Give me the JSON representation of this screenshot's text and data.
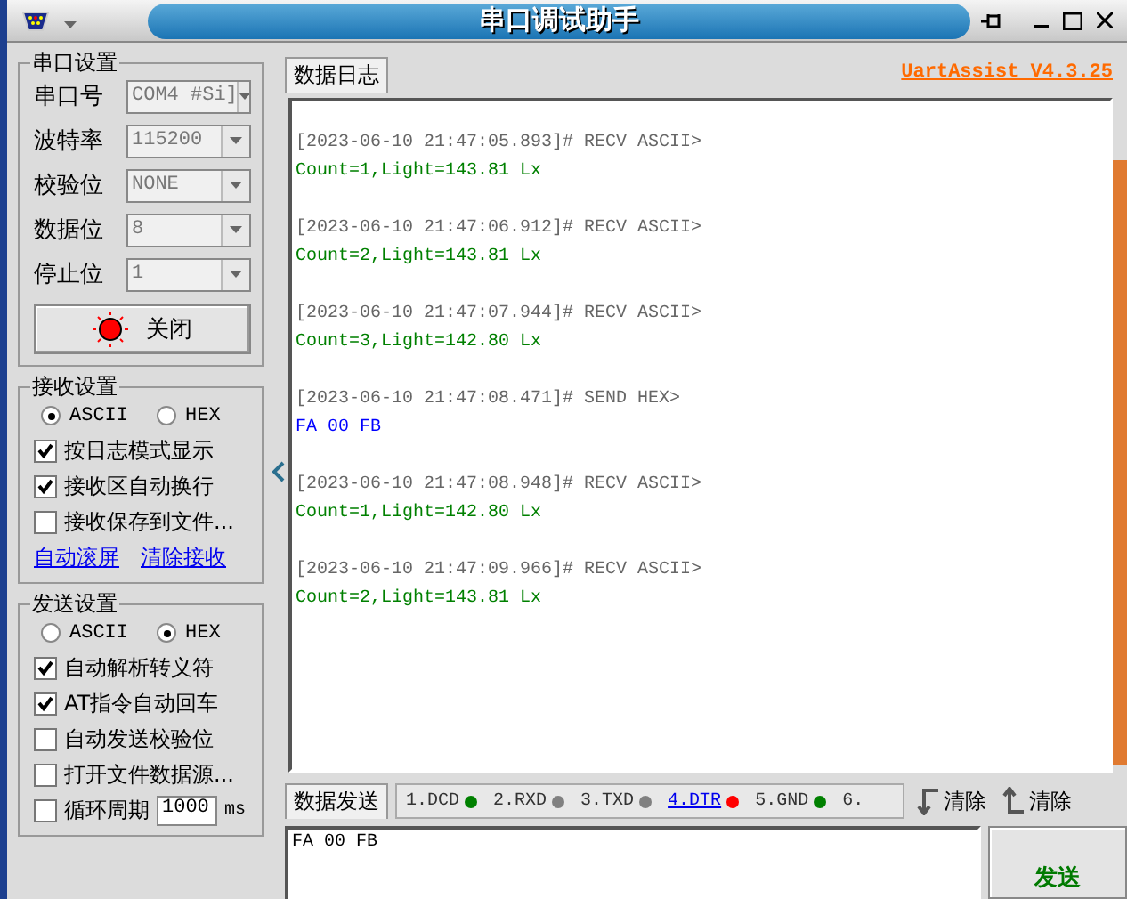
{
  "window": {
    "title": "串口调试助手"
  },
  "port_settings": {
    "title": "串口设置",
    "fields": [
      {
        "label": "串口号",
        "value": "COM4 #Si]"
      },
      {
        "label": "波特率",
        "value": "115200"
      },
      {
        "label": "校验位",
        "value": "NONE"
      },
      {
        "label": "数据位",
        "value": "8"
      },
      {
        "label": "停止位",
        "value": "1"
      }
    ],
    "button": {
      "label": "关闭",
      "on": true
    }
  },
  "receive_settings": {
    "title": "接收设置",
    "modes": [
      {
        "label": "ASCII",
        "selected": true
      },
      {
        "label": "HEX",
        "selected": false
      }
    ],
    "options": [
      {
        "label": "按日志模式显示",
        "checked": true
      },
      {
        "label": "接收区自动换行",
        "checked": true
      },
      {
        "label": "接收保存到文件...",
        "checked": false
      }
    ],
    "links": [
      "自动滚屏",
      "清除接收"
    ]
  },
  "send_settings": {
    "title": "发送设置",
    "modes": [
      {
        "label": "ASCII",
        "selected": false
      },
      {
        "label": "HEX",
        "selected": true
      }
    ],
    "options": [
      {
        "label": "自动解析转义符",
        "checked": true
      },
      {
        "label": "AT指令自动回车",
        "checked": true
      },
      {
        "label": "自动发送校验位",
        "checked": false
      },
      {
        "label": "打开文件数据源...",
        "checked": false
      },
      {
        "label": "循环周期",
        "checked": false
      }
    ],
    "period": {
      "value": "1000",
      "unit": "ms"
    }
  },
  "log_tab": "数据日志",
  "version_link": "UartAssist V4.3.25",
  "log": [
    {
      "kind": "recv",
      "header": "[2023-06-10 21:47:05.893]# RECV ASCII>",
      "payload": "Count=1,Light=143.81 Lx"
    },
    {
      "kind": "recv",
      "header": "[2023-06-10 21:47:06.912]# RECV ASCII>",
      "payload": "Count=2,Light=143.81 Lx"
    },
    {
      "kind": "recv",
      "header": "[2023-06-10 21:47:07.944]# RECV ASCII>",
      "payload": "Count=3,Light=142.80 Lx"
    },
    {
      "kind": "send",
      "header": "[2023-06-10 21:47:08.471]# SEND HEX>",
      "payload": "FA 00 FB"
    },
    {
      "kind": "recv",
      "header": "[2023-06-10 21:47:08.948]# RECV ASCII>",
      "payload": "Count=1,Light=142.80 Lx"
    },
    {
      "kind": "recv",
      "header": "[2023-06-10 21:47:09.966]# RECV ASCII>",
      "payload": "Count=2,Light=143.81 Lx"
    }
  ],
  "send_tab": "数据发送",
  "signals": [
    {
      "label": "1.DCD",
      "color": "#008000",
      "link": false
    },
    {
      "label": "2.RXD",
      "color": "#808080",
      "link": false
    },
    {
      "label": "3.TXD",
      "color": "#808080",
      "link": false
    },
    {
      "label": "4.DTR",
      "color": "#ff0000",
      "link": true
    },
    {
      "label": "5.GND",
      "color": "#008000",
      "link": false
    },
    {
      "label": "6.",
      "link": false
    }
  ],
  "clear_buttons": [
    "清除",
    "清除"
  ],
  "send_text": "FA 00 FB",
  "send_button": "发送"
}
